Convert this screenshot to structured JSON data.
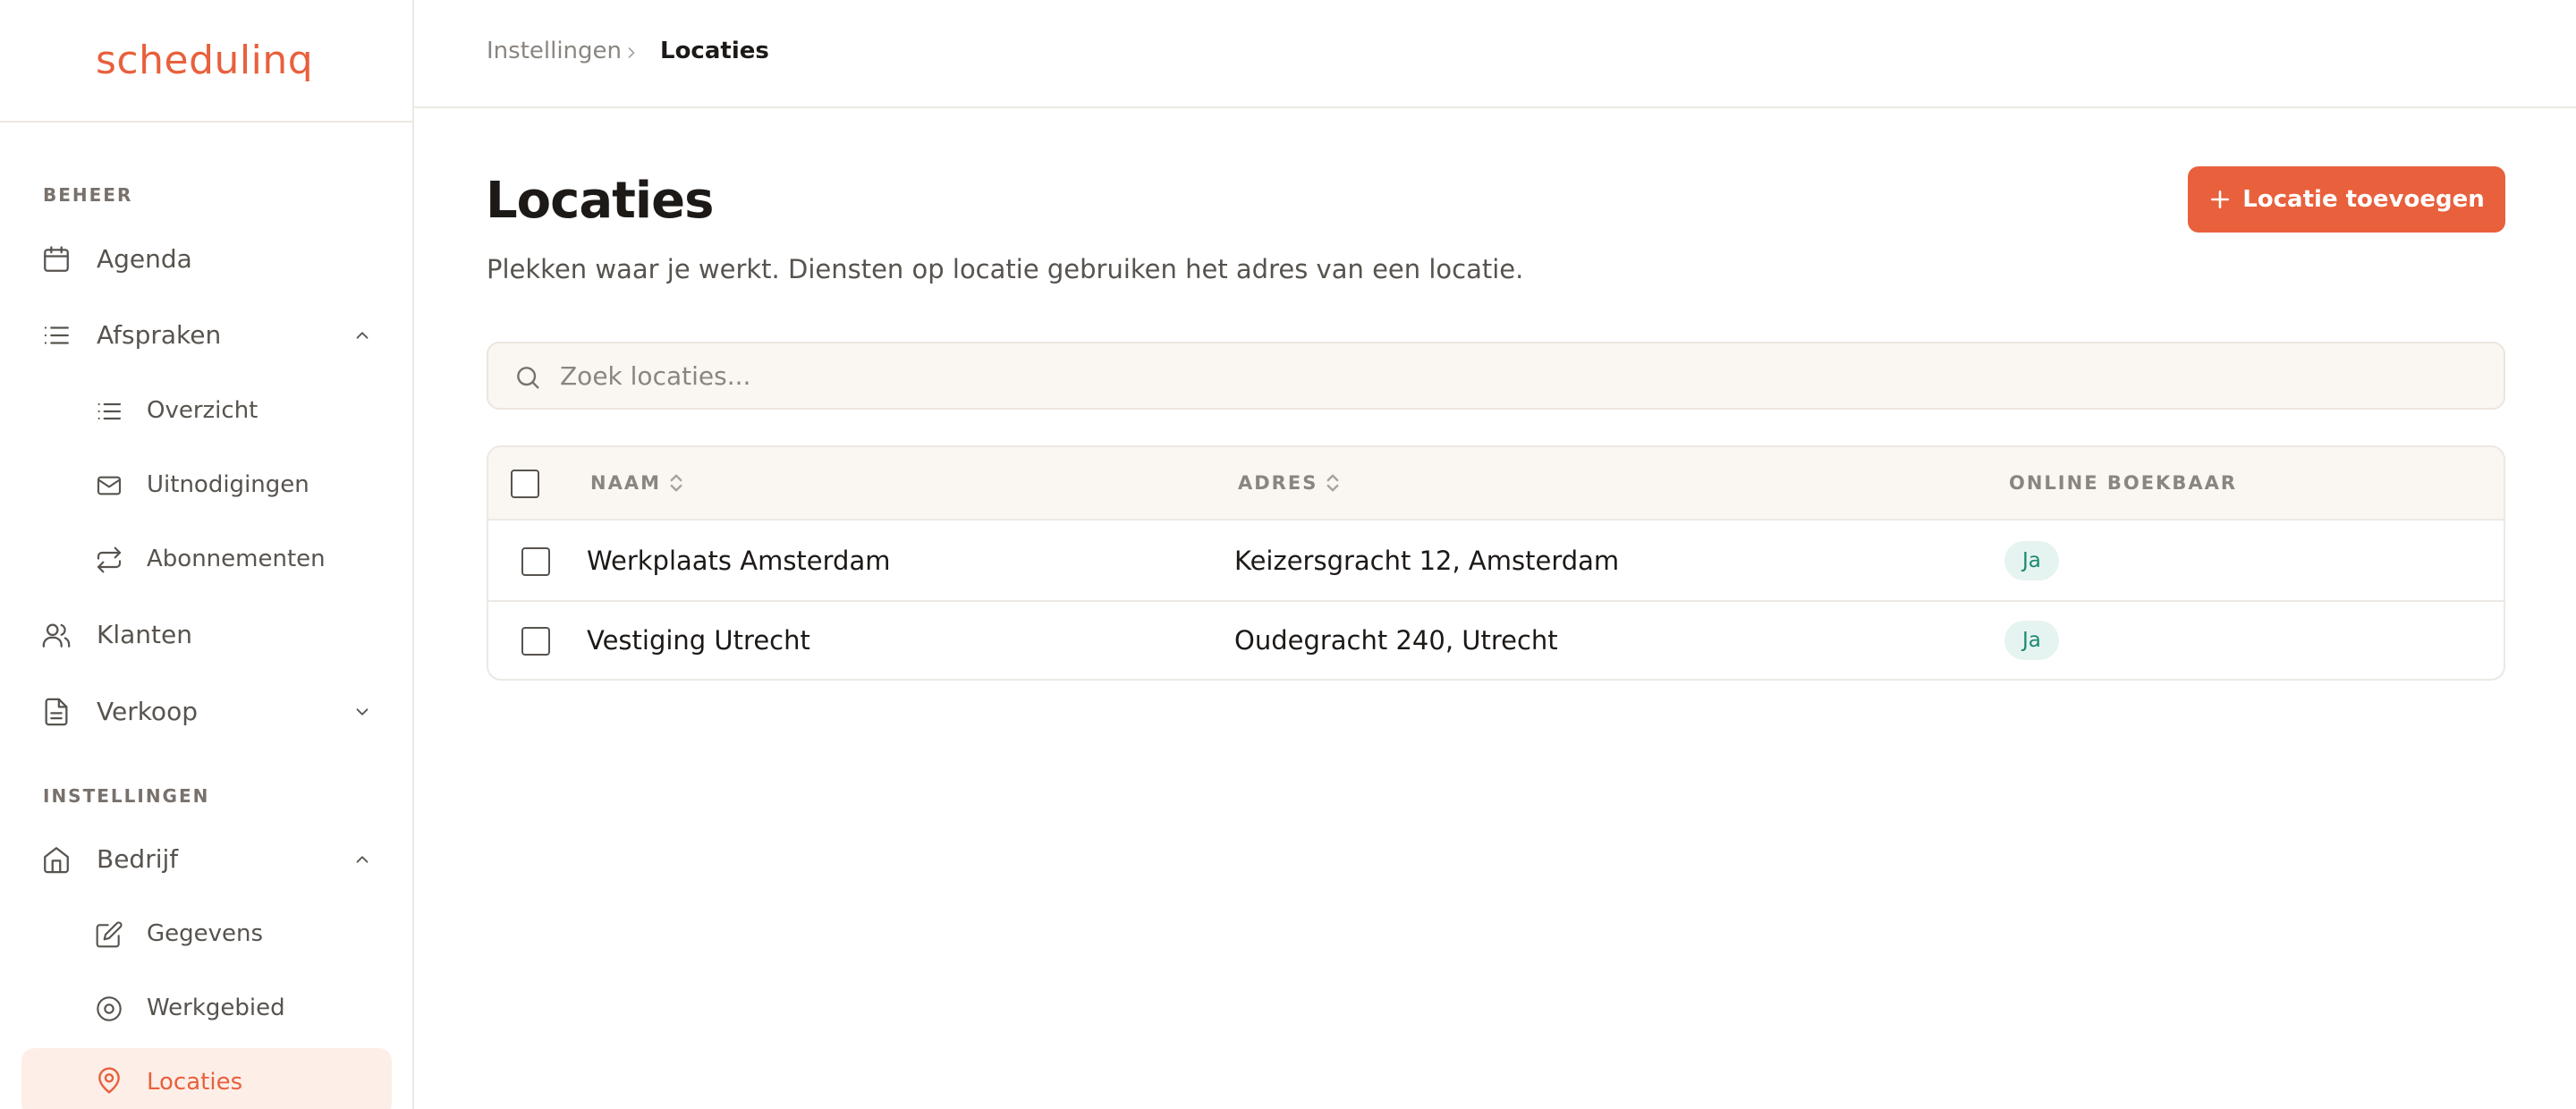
{
  "app": {
    "logo": "schedulinq"
  },
  "sidebar": {
    "sections": {
      "beheer": "BEHEER",
      "instellingen": "INSTELLINGEN"
    },
    "items": {
      "agenda": "Agenda",
      "afspraken": "Afspraken",
      "overzicht": "Overzicht",
      "uitnodigingen": "Uitnodigingen",
      "abonnementen": "Abonnementen",
      "klanten": "Klanten",
      "verkoop": "Verkoop",
      "bedrijf": "Bedrijf",
      "gegevens": "Gegevens",
      "werkgebied": "Werkgebied",
      "locaties": "Locaties"
    }
  },
  "breadcrumb": {
    "parent": "Instellingen",
    "current": "Locaties"
  },
  "page": {
    "title": "Locaties",
    "subtitle": "Plekken waar je werkt. Diensten op locatie gebruiken het adres van een locatie.",
    "add_button": "Locatie toevoegen"
  },
  "search": {
    "placeholder": "Zoek locaties..."
  },
  "table": {
    "headers": {
      "naam": "NAAM",
      "adres": "ADRES",
      "online": "ONLINE BOEKBAAR"
    },
    "rows": [
      {
        "naam": "Werkplaats Amsterdam",
        "adres": "Keizersgracht 12, Amsterdam",
        "online": "Ja"
      },
      {
        "naam": "Vestiging Utrecht",
        "adres": "Oudegracht 240, Utrecht",
        "online": "Ja"
      }
    ]
  },
  "colors": {
    "accent": "#e8603c",
    "active_bg": "#fdeee8",
    "badge_bg": "#e6f4f1",
    "badge_text": "#1a8a73"
  },
  "icons": {
    "agenda": "calendar-icon",
    "afspraken": "list-icon",
    "overzicht": "list-icon",
    "uitnodigingen": "mail-icon",
    "abonnementen": "repeat-icon",
    "klanten": "users-icon",
    "verkoop": "document-icon",
    "bedrijf": "home-icon",
    "gegevens": "edit-icon",
    "werkgebied": "target-icon",
    "locaties": "map-pin-icon"
  }
}
